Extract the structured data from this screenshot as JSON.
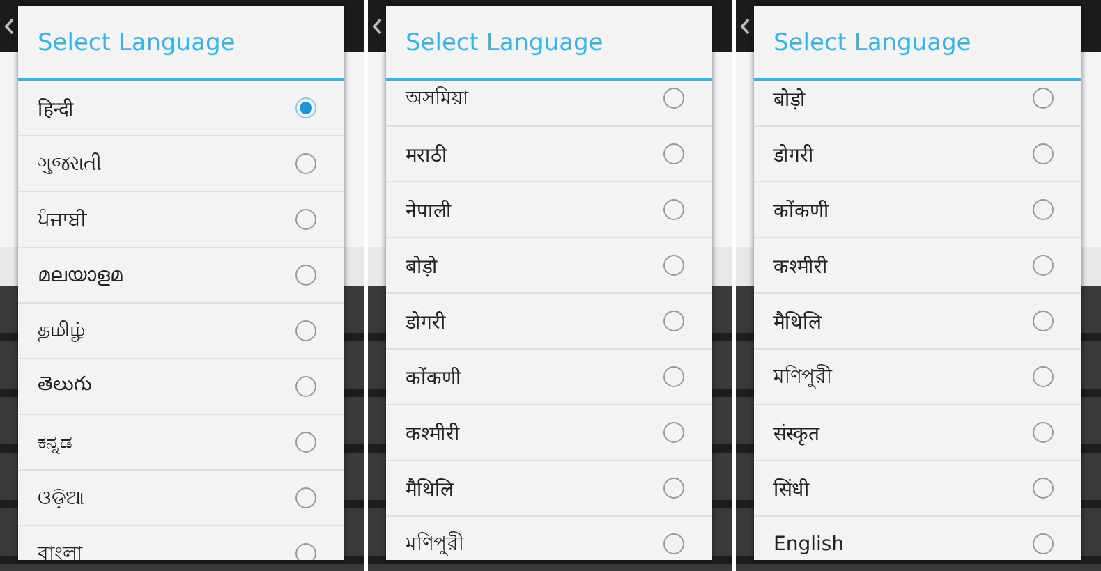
{
  "panels": [
    {
      "title": "Select Language",
      "options": [
        {
          "label": "हिन्दी",
          "selected": true
        },
        {
          "label": "ગુજરાતી",
          "selected": false
        },
        {
          "label": "ਪੰਜਾਬੀ",
          "selected": false
        },
        {
          "label": "മലയാളമ",
          "selected": false
        },
        {
          "label": "தமிழ்",
          "selected": false
        },
        {
          "label": "తెలుగు",
          "selected": false
        },
        {
          "label": "ಕನ್ನಡ",
          "selected": false
        },
        {
          "label": "ଓଡ଼ିଆ",
          "selected": false
        },
        {
          "label": "বাংলা",
          "selected": false
        }
      ]
    },
    {
      "title": "Select Language",
      "options": [
        {
          "label": "অসমিয়া",
          "selected": false
        },
        {
          "label": "मराठी",
          "selected": false
        },
        {
          "label": "नेपाली",
          "selected": false
        },
        {
          "label": "बोड़ो",
          "selected": false
        },
        {
          "label": "डोगरी",
          "selected": false
        },
        {
          "label": "कोंकणी",
          "selected": false
        },
        {
          "label": "कश्मीरी",
          "selected": false
        },
        {
          "label": "मैथिलि",
          "selected": false
        },
        {
          "label": "মণিপুরী",
          "selected": false
        }
      ]
    },
    {
      "title": "Select Language",
      "options": [
        {
          "label": "बोड़ो",
          "selected": false
        },
        {
          "label": "डोगरी",
          "selected": false
        },
        {
          "label": "कोंकणी",
          "selected": false
        },
        {
          "label": "कश्मीरी",
          "selected": false
        },
        {
          "label": "मैथिलि",
          "selected": false
        },
        {
          "label": "মণিপুরী",
          "selected": false
        },
        {
          "label": "संस्कृत",
          "selected": false
        },
        {
          "label": "सिंधी",
          "selected": false
        },
        {
          "label": "English",
          "selected": false
        }
      ]
    }
  ]
}
